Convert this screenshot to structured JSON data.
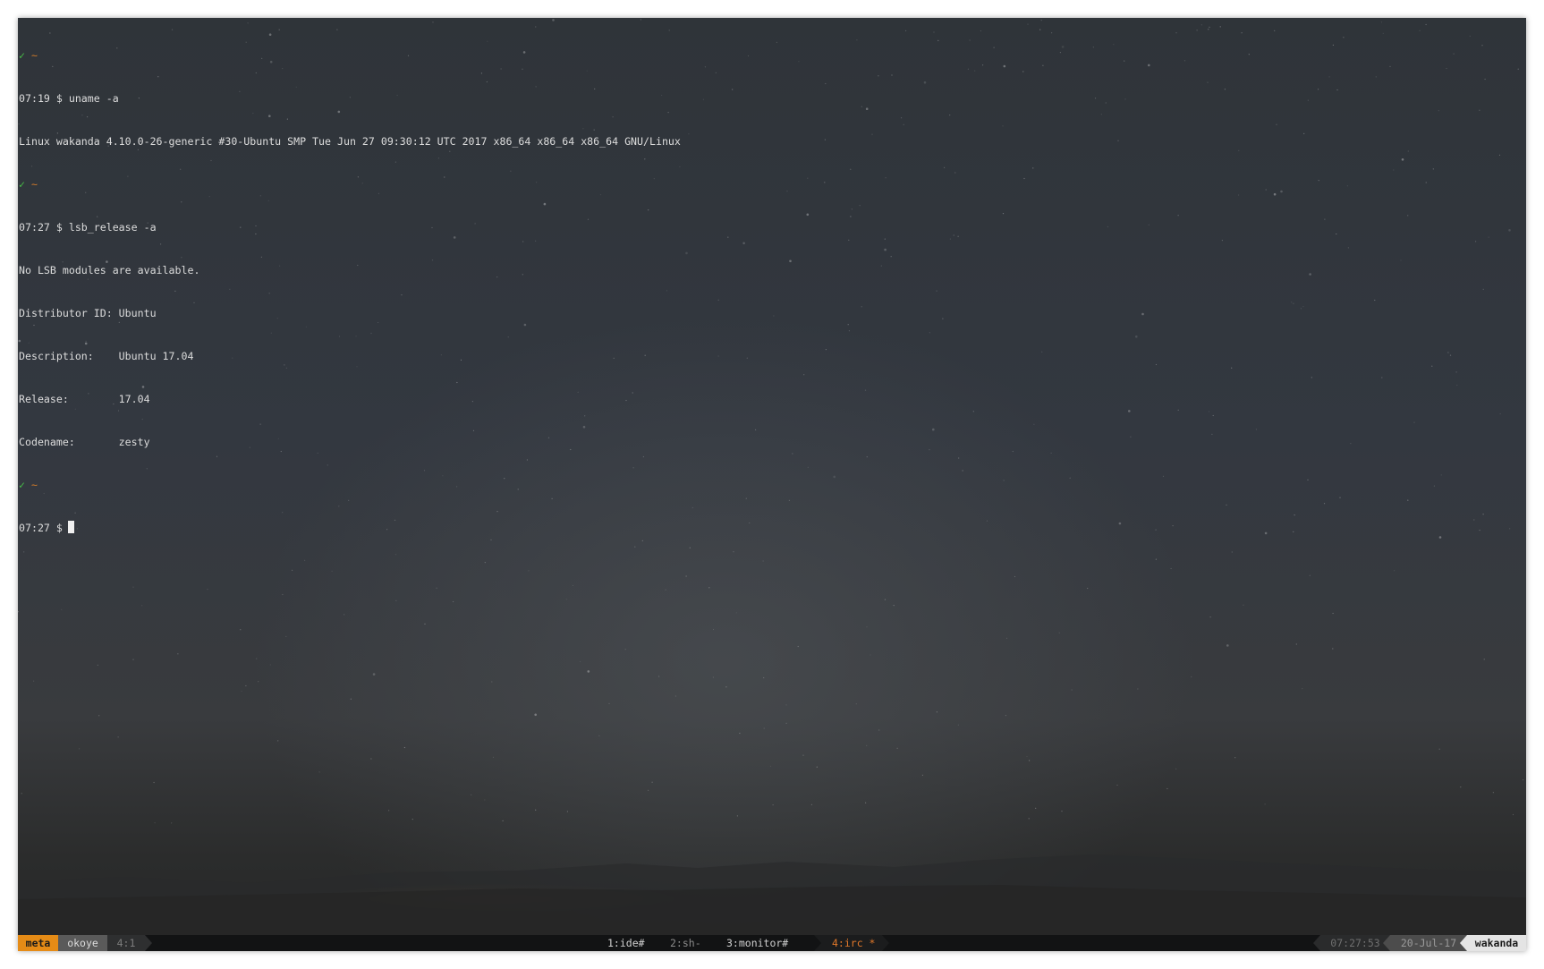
{
  "terminal": {
    "lines": [
      {
        "type": "status",
        "check": "✓",
        "dir": "~"
      },
      {
        "type": "text",
        "text": "07:19 $ uname -a"
      },
      {
        "type": "text",
        "text": "Linux wakanda 4.10.0-26-generic #30-Ubuntu SMP Tue Jun 27 09:30:12 UTC 2017 x86_64 x86_64 x86_64 GNU/Linux"
      },
      {
        "type": "status",
        "check": "✓",
        "dir": "~"
      },
      {
        "type": "text",
        "text": "07:27 $ lsb_release -a"
      },
      {
        "type": "text",
        "text": "No LSB modules are available."
      },
      {
        "type": "text",
        "text": "Distributor ID: Ubuntu"
      },
      {
        "type": "text",
        "text": "Description:    Ubuntu 17.04"
      },
      {
        "type": "text",
        "text": "Release:        17.04"
      },
      {
        "type": "text",
        "text": "Codename:       zesty"
      },
      {
        "type": "status",
        "check": "✓",
        "dir": "~"
      },
      {
        "type": "prompt",
        "text": "07:27 $"
      }
    ]
  },
  "statusbar": {
    "session": "meta",
    "user": "okoye",
    "pane": "4:1",
    "windows": [
      {
        "label": "1:ide#",
        "active": false
      },
      {
        "label": "2:sh-",
        "active": false
      },
      {
        "label": "3:monitor#",
        "active": false
      },
      {
        "label": "4:irc *",
        "active": true
      }
    ],
    "time": "07:27:53",
    "date": "20-Jul-17",
    "host": "wakanda"
  },
  "colors": {
    "session_bg": "#e58b16",
    "active_window": "#e0782a",
    "prompt_check": "#48c048",
    "prompt_dir": "#d07a2a",
    "terminal_text": "#dcdcdc",
    "statusbar_bg": "#121314"
  }
}
